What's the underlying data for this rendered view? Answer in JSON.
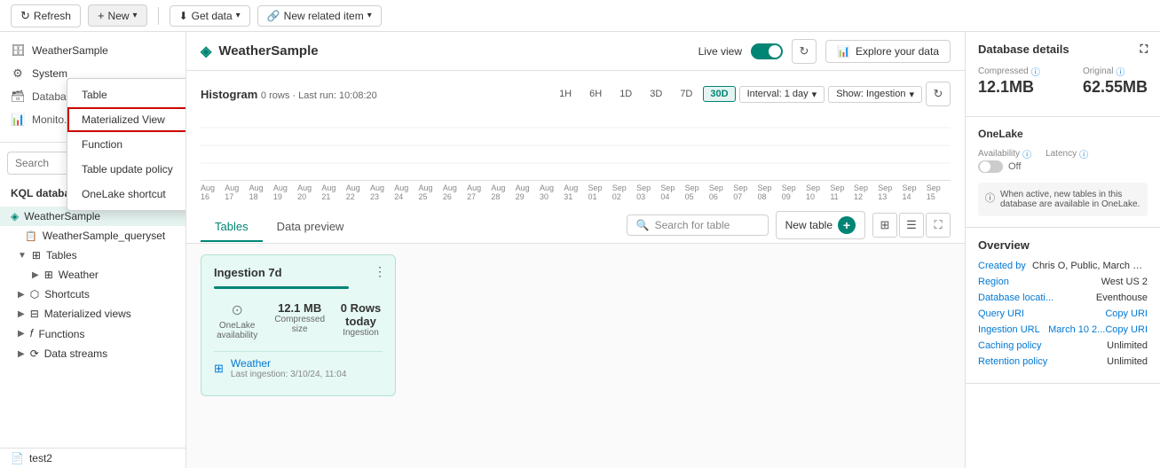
{
  "toolbar": {
    "refresh_label": "Refresh",
    "new_label": "New",
    "get_data_label": "Get data",
    "new_related_label": "New related item"
  },
  "dropdown": {
    "items": [
      {
        "label": "Table",
        "highlighted": false
      },
      {
        "label": "Materialized View",
        "highlighted": true
      },
      {
        "label": "Function",
        "highlighted": false
      },
      {
        "label": "Table update policy",
        "highlighted": false
      },
      {
        "label": "OneLake shortcut",
        "highlighted": false
      }
    ]
  },
  "sidebar": {
    "search_placeholder": "Search",
    "system_label": "System",
    "databases_label": "KQL databases",
    "add_database_label": "+",
    "db_name": "WeatherSample",
    "queryset_label": "WeatherSample_queryset",
    "tables_label": "Tables",
    "weather_table": "Weather",
    "shortcuts_label": "Shortcuts",
    "mat_views_label": "Materialized views",
    "functions_label": "Functions",
    "data_streams_label": "Data streams",
    "test2_label": "test2"
  },
  "content_header": {
    "title": "WeatherSample",
    "live_view_label": "Live view",
    "explore_label": "Explore your data"
  },
  "histogram": {
    "title": "Histogram",
    "rows_label": "0 rows",
    "last_run_label": "Last run: 10:08:20",
    "time_buttons": [
      "1H",
      "6H",
      "1D",
      "3D",
      "7D",
      "30D"
    ],
    "active_time": "30D",
    "interval_label": "Interval: 1 day",
    "show_label": "Show: Ingestion",
    "dates": [
      "Aug 16",
      "Aug 17",
      "Aug 18",
      "Aug 19",
      "Aug 20",
      "Aug 21",
      "Aug 22",
      "Aug 23",
      "Aug 24",
      "Aug 25",
      "Aug 26",
      "Aug 27",
      "Aug 28",
      "Aug 29",
      "Aug 30",
      "Aug 31",
      "Sep 01",
      "Sep 02",
      "Sep 03",
      "Sep 04",
      "Sep 05",
      "Sep 06",
      "Sep 07",
      "Sep 08",
      "Sep 09",
      "Sep 10",
      "Sep 11",
      "Sep 12",
      "Sep 13",
      "Sep 14",
      "Sep 15"
    ]
  },
  "tabs": {
    "tables_label": "Tables",
    "data_preview_label": "Data preview",
    "search_placeholder": "Search for table",
    "new_table_label": "New table"
  },
  "ingestion_card": {
    "title": "Ingestion 7d",
    "onelake_label": "OneLake availability",
    "compressed_label": "Compressed size",
    "compressed_value": "12.1 MB",
    "ingestion_label": "Ingestion",
    "rows_today": "0 Rows today",
    "table_name": "Weather",
    "last_ingestion": "Last ingestion: 3/10/24, 11:04"
  },
  "right_panel": {
    "db_details_title": "Database details",
    "compressed_label": "Compressed",
    "compressed_value": "12.1MB",
    "original_label": "Original",
    "original_value": "62.55MB",
    "onelake_title": "OneLake",
    "availability_label": "Availability",
    "latency_label": "Latency",
    "off_label": "Off",
    "info_text": "When active, new tables in this database are available in OneLake.",
    "overview_title": "Overview",
    "overview_rows": [
      {
        "key": "Created by",
        "value": "Chris O, Public, March 10, i..."
      },
      {
        "key": "Region",
        "value": "West US 2"
      },
      {
        "key": "Database locati...",
        "value": "Eventhouse"
      },
      {
        "key": "Query URI",
        "value": "Copy URI"
      },
      {
        "key": "Ingestion URL",
        "value": "March 10 2...Copy URI"
      },
      {
        "key": "Caching policy",
        "value": "Unlimited"
      },
      {
        "key": "Retention policy",
        "value": "Unlimited"
      }
    ]
  }
}
